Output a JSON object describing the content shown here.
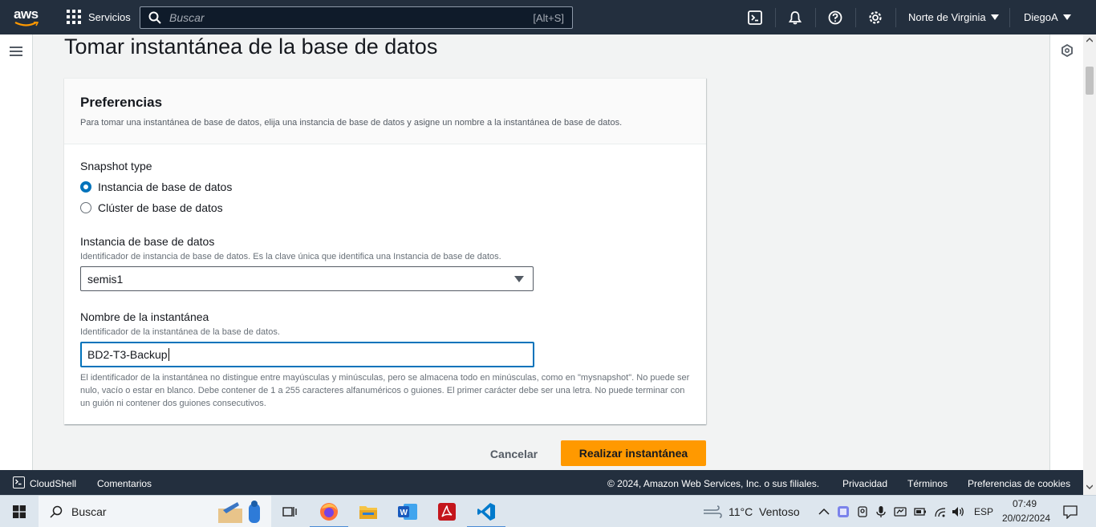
{
  "nav": {
    "logo_text": "aws",
    "services_label": "Servicios",
    "search_placeholder": "Buscar",
    "search_shortcut": "[Alt+S]",
    "region": "Norte de Virginia",
    "user": "DiegoA"
  },
  "page": {
    "title": "Tomar instantánea de la base de datos"
  },
  "preferences": {
    "title": "Preferencias",
    "description": "Para tomar una instantánea de base de datos, elija una instancia de base de datos y asigne un nombre a la instantánea de base de datos.",
    "snapshot_type_label": "Snapshot type",
    "options": [
      {
        "label": "Instancia de base de datos",
        "selected": true
      },
      {
        "label": "Clúster de base de datos",
        "selected": false
      }
    ],
    "instance_label": "Instancia de base de datos",
    "instance_help": "Identificador de instancia de base de datos. Es la clave única que identifica una Instancia de base de datos.",
    "instance_value": "semis1",
    "snapshot_name_label": "Nombre de la instantánea",
    "snapshot_name_help": "Identificador de la instantánea de la base de datos.",
    "snapshot_name_value": "BD2-T3-Backup",
    "constraint_text": "El identificador de la instantánea no distingue entre mayúsculas y minúsculas, pero se almacena todo en minúsculas, como en \"mysnapshot\". No puede ser nulo, vacío o estar en blanco. Debe contener de 1 a 255 caracteres alfanuméricos o guiones. El primer carácter debe ser una letra. No puede terminar con un guión ni contener dos guiones consecutivos."
  },
  "actions": {
    "cancel": "Cancelar",
    "submit": "Realizar instantánea"
  },
  "footer": {
    "cloudshell": "CloudShell",
    "feedback": "Comentarios",
    "copyright": "© 2024, Amazon Web Services, Inc. o sus filiales.",
    "privacy": "Privacidad",
    "terms": "Términos",
    "cookies": "Preferencias de cookies"
  },
  "taskbar": {
    "search_label": "Buscar",
    "weather_temp": "11°C",
    "weather_desc": "Ventoso",
    "language": "ESP",
    "time": "07:49",
    "date": "20/02/2024"
  },
  "colors": {
    "nav_bg": "#232f3e",
    "primary": "#ff9900",
    "focus": "#0073bb"
  }
}
